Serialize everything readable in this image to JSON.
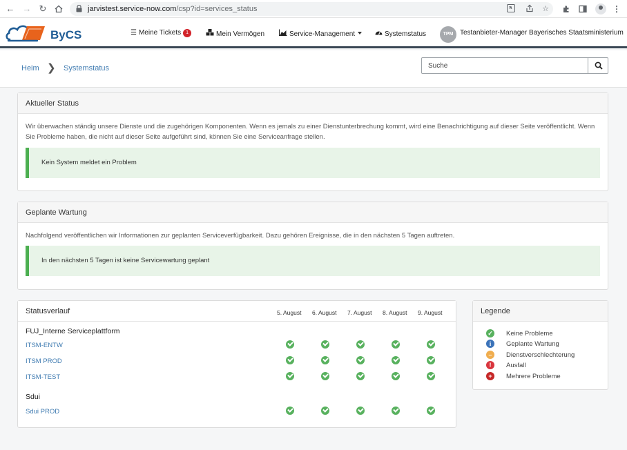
{
  "browser": {
    "url_host": "jarvistest.service-now.com",
    "url_path": "/csp?id=services_status"
  },
  "header": {
    "logo_text": "ByCS",
    "nav": {
      "tickets_label": "Meine Tickets",
      "tickets_count": "1",
      "assets_label": "Mein Vermögen",
      "service_mgmt_label": "Service-Management",
      "system_status_label": "Systemstatus"
    },
    "user": {
      "initials": "TPM",
      "name": "Testanbieter-Manager Bayerisches Staatsministerium"
    }
  },
  "breadcrumb": {
    "home": "Heim",
    "current": "Systemstatus"
  },
  "search": {
    "placeholder": "Suche"
  },
  "current_status": {
    "title": "Aktueller Status",
    "text": "Wir überwachen ständig unsere Dienste und die zugehörigen Komponenten. Wenn es jemals zu einer Dienstunterbrechung kommt, wird eine Benachrichtigung auf dieser Seite veröffentlicht. Wenn Sie Probleme haben, die nicht auf dieser Seite aufgeführt sind, können Sie eine Serviceanfrage stellen.",
    "alert": "Kein System meldet ein Problem"
  },
  "maintenance": {
    "title": "Geplante Wartung",
    "text": "Nachfolgend veröffentlichen wir Informationen zur geplanten Serviceverfügbarkeit. Dazu gehören Ereignisse, die in den nächsten 5 Tagen auftreten.",
    "alert": "In den nächsten 5 Tagen ist keine Servicewartung geplant"
  },
  "history": {
    "title": "Statusverlauf",
    "dates": [
      "5. August",
      "6. August",
      "7. August",
      "8. August",
      "9. August"
    ],
    "groups": [
      {
        "name": "FUJ_Interne Serviceplattform",
        "services": [
          {
            "name": "ITSM-ENTW",
            "status": [
              "ok",
              "ok",
              "ok",
              "ok",
              "ok"
            ]
          },
          {
            "name": "ITSM PROD",
            "status": [
              "ok",
              "ok",
              "ok",
              "ok",
              "ok"
            ]
          },
          {
            "name": "ITSM-TEST",
            "status": [
              "ok",
              "ok",
              "ok",
              "ok",
              "ok"
            ]
          }
        ]
      },
      {
        "name": "Sdui",
        "services": [
          {
            "name": "Sdui PROD",
            "status": [
              "ok",
              "ok",
              "ok",
              "ok",
              "ok"
            ]
          }
        ]
      }
    ]
  },
  "legend": {
    "title": "Legende",
    "items": [
      {
        "label": "Keine Probleme",
        "icon": "check-circle-icon",
        "color": "#58b15e"
      },
      {
        "label": "Geplante Wartung",
        "icon": "info-circle-icon",
        "color": "#3b73b9"
      },
      {
        "label": "Dienstverschlechterung",
        "icon": "minus-circle-icon",
        "color": "#f0ad4e"
      },
      {
        "label": "Ausfall",
        "icon": "exclamation-circle-icon",
        "color": "#d9363e"
      },
      {
        "label": "Mehrere Probleme",
        "icon": "plus-circle-icon",
        "color": "#c62828"
      }
    ]
  }
}
